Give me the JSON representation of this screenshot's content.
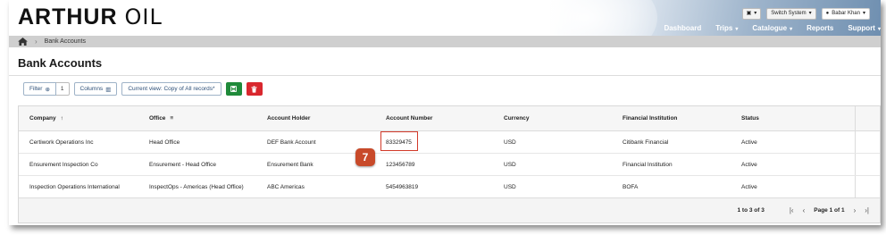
{
  "app": {
    "logo_main": "ARTHUR",
    "logo_suffix": "OIL",
    "switch_system": "Switch System",
    "user_name": "Babar Khan"
  },
  "nav": [
    "Dashboard",
    "Trips",
    "Catalogue",
    "Reports",
    "Support"
  ],
  "breadcrumb": {
    "current": "Bank Accounts"
  },
  "page": {
    "title": "Bank Accounts"
  },
  "toolbar": {
    "filter": "Filter",
    "filter_count": "1",
    "columns": "Columns",
    "current_view": "Current view: Copy of All records*"
  },
  "columns": [
    "Company",
    "Office",
    "Account Holder",
    "Account Number",
    "Currency",
    "Financial Institution",
    "Status"
  ],
  "rows": [
    [
      "Certiwork Operations Inc",
      "Head Office",
      "DEF Bank Account",
      "83329475",
      "USD",
      "Citibank Financial",
      "Active"
    ],
    [
      "Ensurement Inspection Co",
      "Ensurement - Head Office",
      "Ensurement Bank",
      "123456789",
      "USD",
      "Financial Institution",
      "Active"
    ],
    [
      "Inspection Operations International",
      "InspectOps - Americas (Head Office)",
      "ABC Americas",
      "5454963819",
      "USD",
      "BOFA",
      "Active"
    ]
  ],
  "pagination": {
    "range": "1 to 3 of 3",
    "page": "Page 1 of 1"
  },
  "callout": {
    "number": "7"
  },
  "colors": {
    "link": "#1f5aa6",
    "save": "#1f8a3a",
    "delete": "#d9272e",
    "callout": "#c84a2a"
  }
}
